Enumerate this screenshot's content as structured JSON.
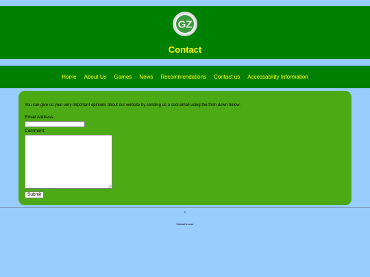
{
  "logo": {
    "text": "GZ",
    "ring_color": "#d0d0d0",
    "inner_color": "#3f9a3f"
  },
  "header": {
    "title": "Contact"
  },
  "nav": {
    "items": [
      {
        "label": "Home"
      },
      {
        "label": "About Us"
      },
      {
        "label": "Games"
      },
      {
        "label": "News"
      },
      {
        "label": "Recommendations"
      },
      {
        "label": "Contact us"
      },
      {
        "label": "Accessability Information"
      }
    ]
  },
  "form": {
    "intro": "You can give us your very important opinions about our website by sending us a cool email using the form down below.",
    "email_label": "Email Address:",
    "email_value": "",
    "comment_label": "Comment:",
    "comment_value": "",
    "submit_label": "Submit"
  },
  "footer": {
    "back_link": "<",
    "site_name": "thetwehezone"
  },
  "colors": {
    "page_bg": "#99ccff",
    "header_bg": "#008000",
    "panel_bg": "#4caa14",
    "accent_text": "#ffff00"
  }
}
